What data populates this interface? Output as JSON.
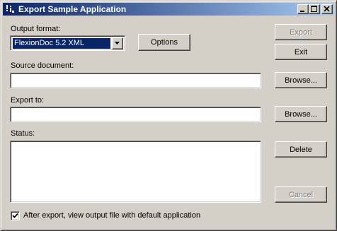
{
  "window": {
    "title": "Export Sample Application"
  },
  "output_format": {
    "label": "Output format:",
    "selected": "FlexionDoc 5.2 XML",
    "options_button": "Options"
  },
  "source_document": {
    "label": "Source document:",
    "value": "",
    "browse_button": "Browse..."
  },
  "export_to": {
    "label": "Export to:",
    "value": "",
    "browse_button": "Browse..."
  },
  "status": {
    "label": "Status:",
    "value": ""
  },
  "buttons": {
    "export": "Export",
    "exit": "Exit",
    "delete": "Delete",
    "cancel": "Cancel"
  },
  "view_output": {
    "label": "After export, view output file with default application",
    "checked": true
  },
  "icons": {
    "app": "app-icon",
    "minimize": "minimize-icon",
    "maximize": "maximize-icon",
    "close": "close-icon",
    "dropdown": "chevron-down-icon",
    "check": "checkmark-icon"
  }
}
